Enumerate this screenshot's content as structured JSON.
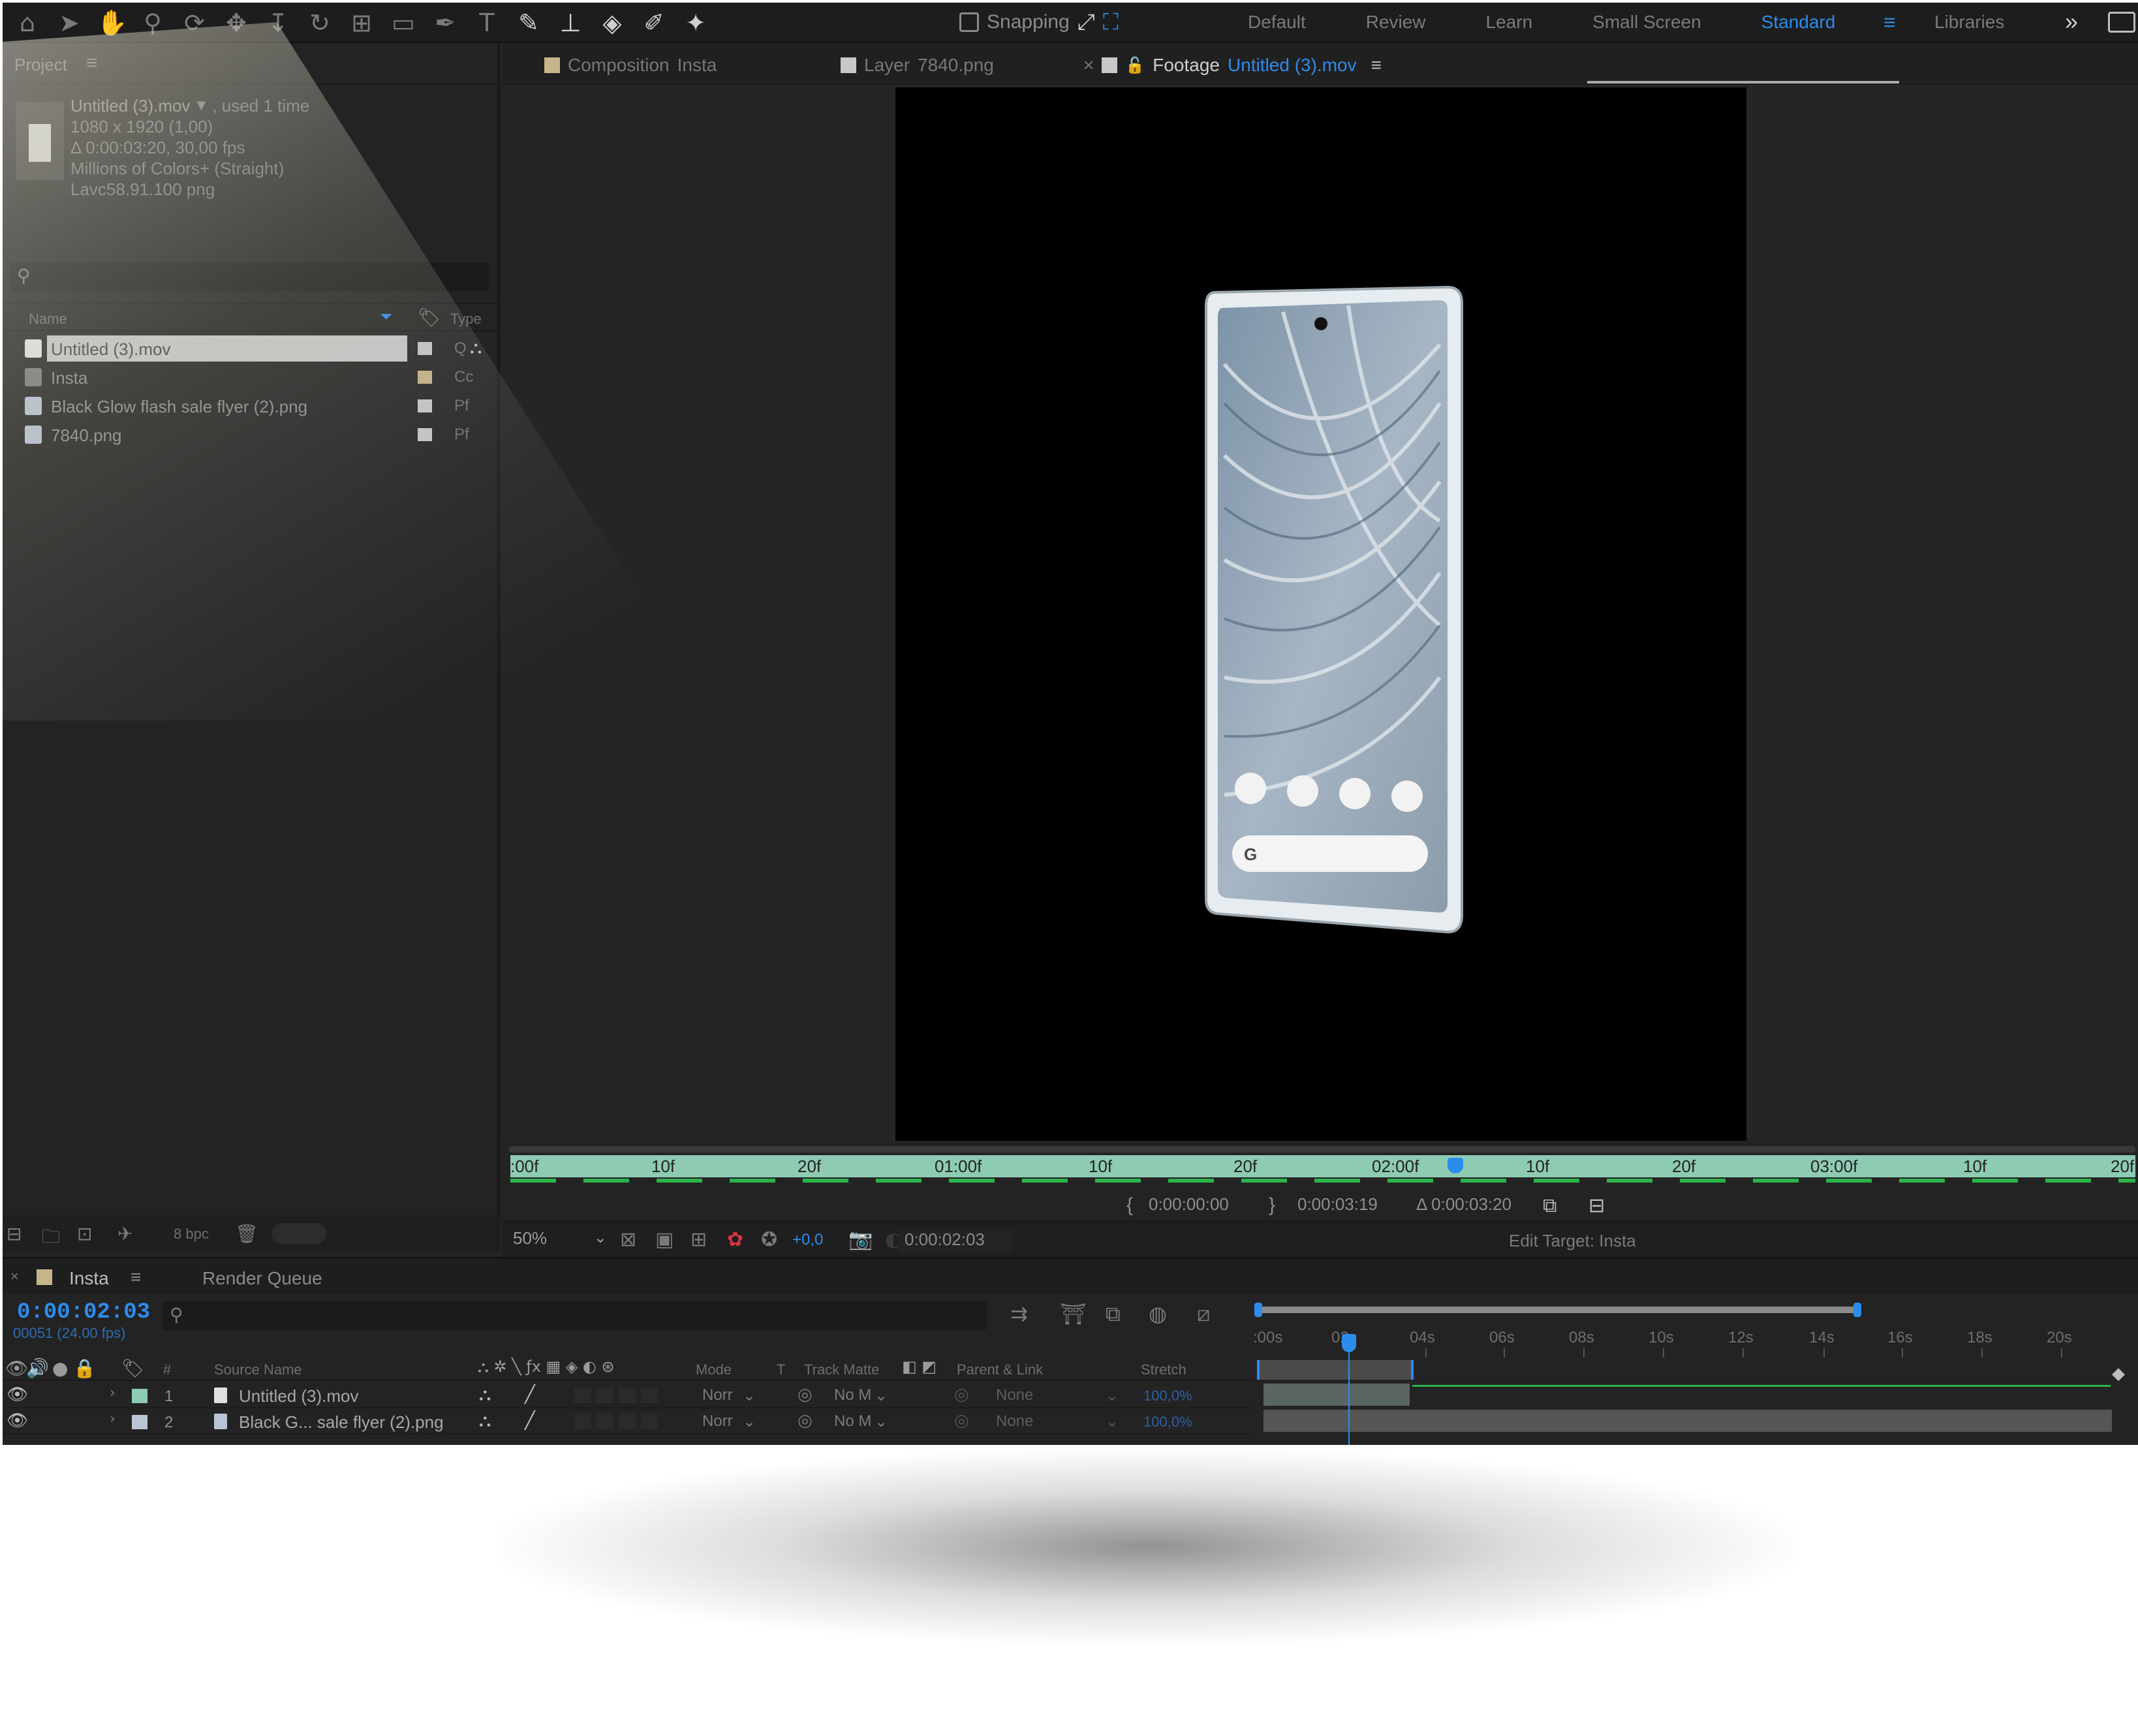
{
  "toolbar": {
    "tools": [
      "home-icon",
      "selection-tool-icon",
      "hand-tool-icon",
      "zoom-tool-icon",
      "orbit-camera-icon",
      "pan-camera-icon",
      "dolly-camera-icon",
      "rotate-tool-icon",
      "pan-behind-icon",
      "rectangle-tool-icon",
      "pen-tool-icon",
      "type-tool-icon",
      "brush-tool-icon",
      "clone-stamp-icon",
      "eraser-tool-icon",
      "roto-brush-icon",
      "puppet-pin-icon"
    ],
    "snapping_label": "Snapping",
    "workspaces": [
      "Default",
      "Review",
      "Learn",
      "Small Screen",
      "Standard"
    ],
    "active_workspace": "Standard",
    "libraries_label": "Libraries",
    "more_symbol": "»"
  },
  "project": {
    "title": "Project",
    "menu_symbol": "≡",
    "footage_name": "Untitled (3).mov",
    "footage_usage": ", used 1 time",
    "footage_dims": "1080 x 1920 (1,00)",
    "footage_duration": "Δ 0:00:03:20, 30,00 fps",
    "footage_colors": "Millions of Colors+ (Straight)",
    "footage_codec": "Lavc58.91.100 png",
    "col_name": "Name",
    "col_type": "Type",
    "items": [
      {
        "name": "Untitled (3).mov",
        "type": "Q",
        "selected": true
      },
      {
        "name": "Insta",
        "type": "Cc"
      },
      {
        "name": "Black Glow flash sale flyer (2).png",
        "type": "Pf"
      },
      {
        "name": "7840.png",
        "type": "Pf"
      }
    ],
    "bpc_label": "8 bpc"
  },
  "viewer": {
    "tabs": [
      {
        "prefix": "Composition",
        "name": "Insta"
      },
      {
        "prefix": "Layer",
        "name": "7840.png"
      },
      {
        "prefix": "Footage",
        "name": "Untitled (3).mov"
      }
    ],
    "close_symbol": "×",
    "menu_symbol": "≡",
    "ruler_ticks": [
      ":00f",
      "10f",
      "20f",
      "01:00f",
      "10f",
      "20f",
      "02:00f",
      "10f",
      "20f",
      "03:00f",
      "10f",
      "20f"
    ],
    "in_point": "0:00:00:00",
    "out_point": "0:00:03:19",
    "duration": "Δ 0:00:03:20",
    "zoom": "50%",
    "exposure": "+0,0",
    "current_time": "0:00:02:03",
    "edit_target": "Edit Target: Insta",
    "colors": {
      "accent": "#2d8ceb",
      "ruler": "#8ecbb3",
      "cache": "#2cb34a"
    }
  },
  "timeline": {
    "comp_tab": "Insta",
    "render_queue": "Render Queue",
    "menu_symbol": "≡",
    "close_symbol": "×",
    "current_time": "0:00:02:03",
    "frames": "00051 (24.00 fps)",
    "ticks": [
      ":00s",
      "02s",
      "04s",
      "06s",
      "08s",
      "10s",
      "12s",
      "14s",
      "16s",
      "18s",
      "20s"
    ],
    "columns": {
      "hash": "#",
      "source_name": "Source Name",
      "mode": "Mode",
      "t": "T",
      "track_matte": "Track Matte",
      "parent": "Parent & Link",
      "stretch": "Stretch"
    },
    "layers": [
      {
        "num": "1",
        "name": "Untitled (3).mov",
        "mode": "Norr",
        "matte": "No M",
        "parent": "None",
        "stretch": "100,0%",
        "label_color": "#8ecbb3"
      },
      {
        "num": "2",
        "name": "Black G... sale flyer (2).png",
        "mode": "Norr",
        "matte": "No M",
        "parent": "None",
        "stretch": "100,0%",
        "label_color": "#b9c4d6"
      }
    ]
  }
}
